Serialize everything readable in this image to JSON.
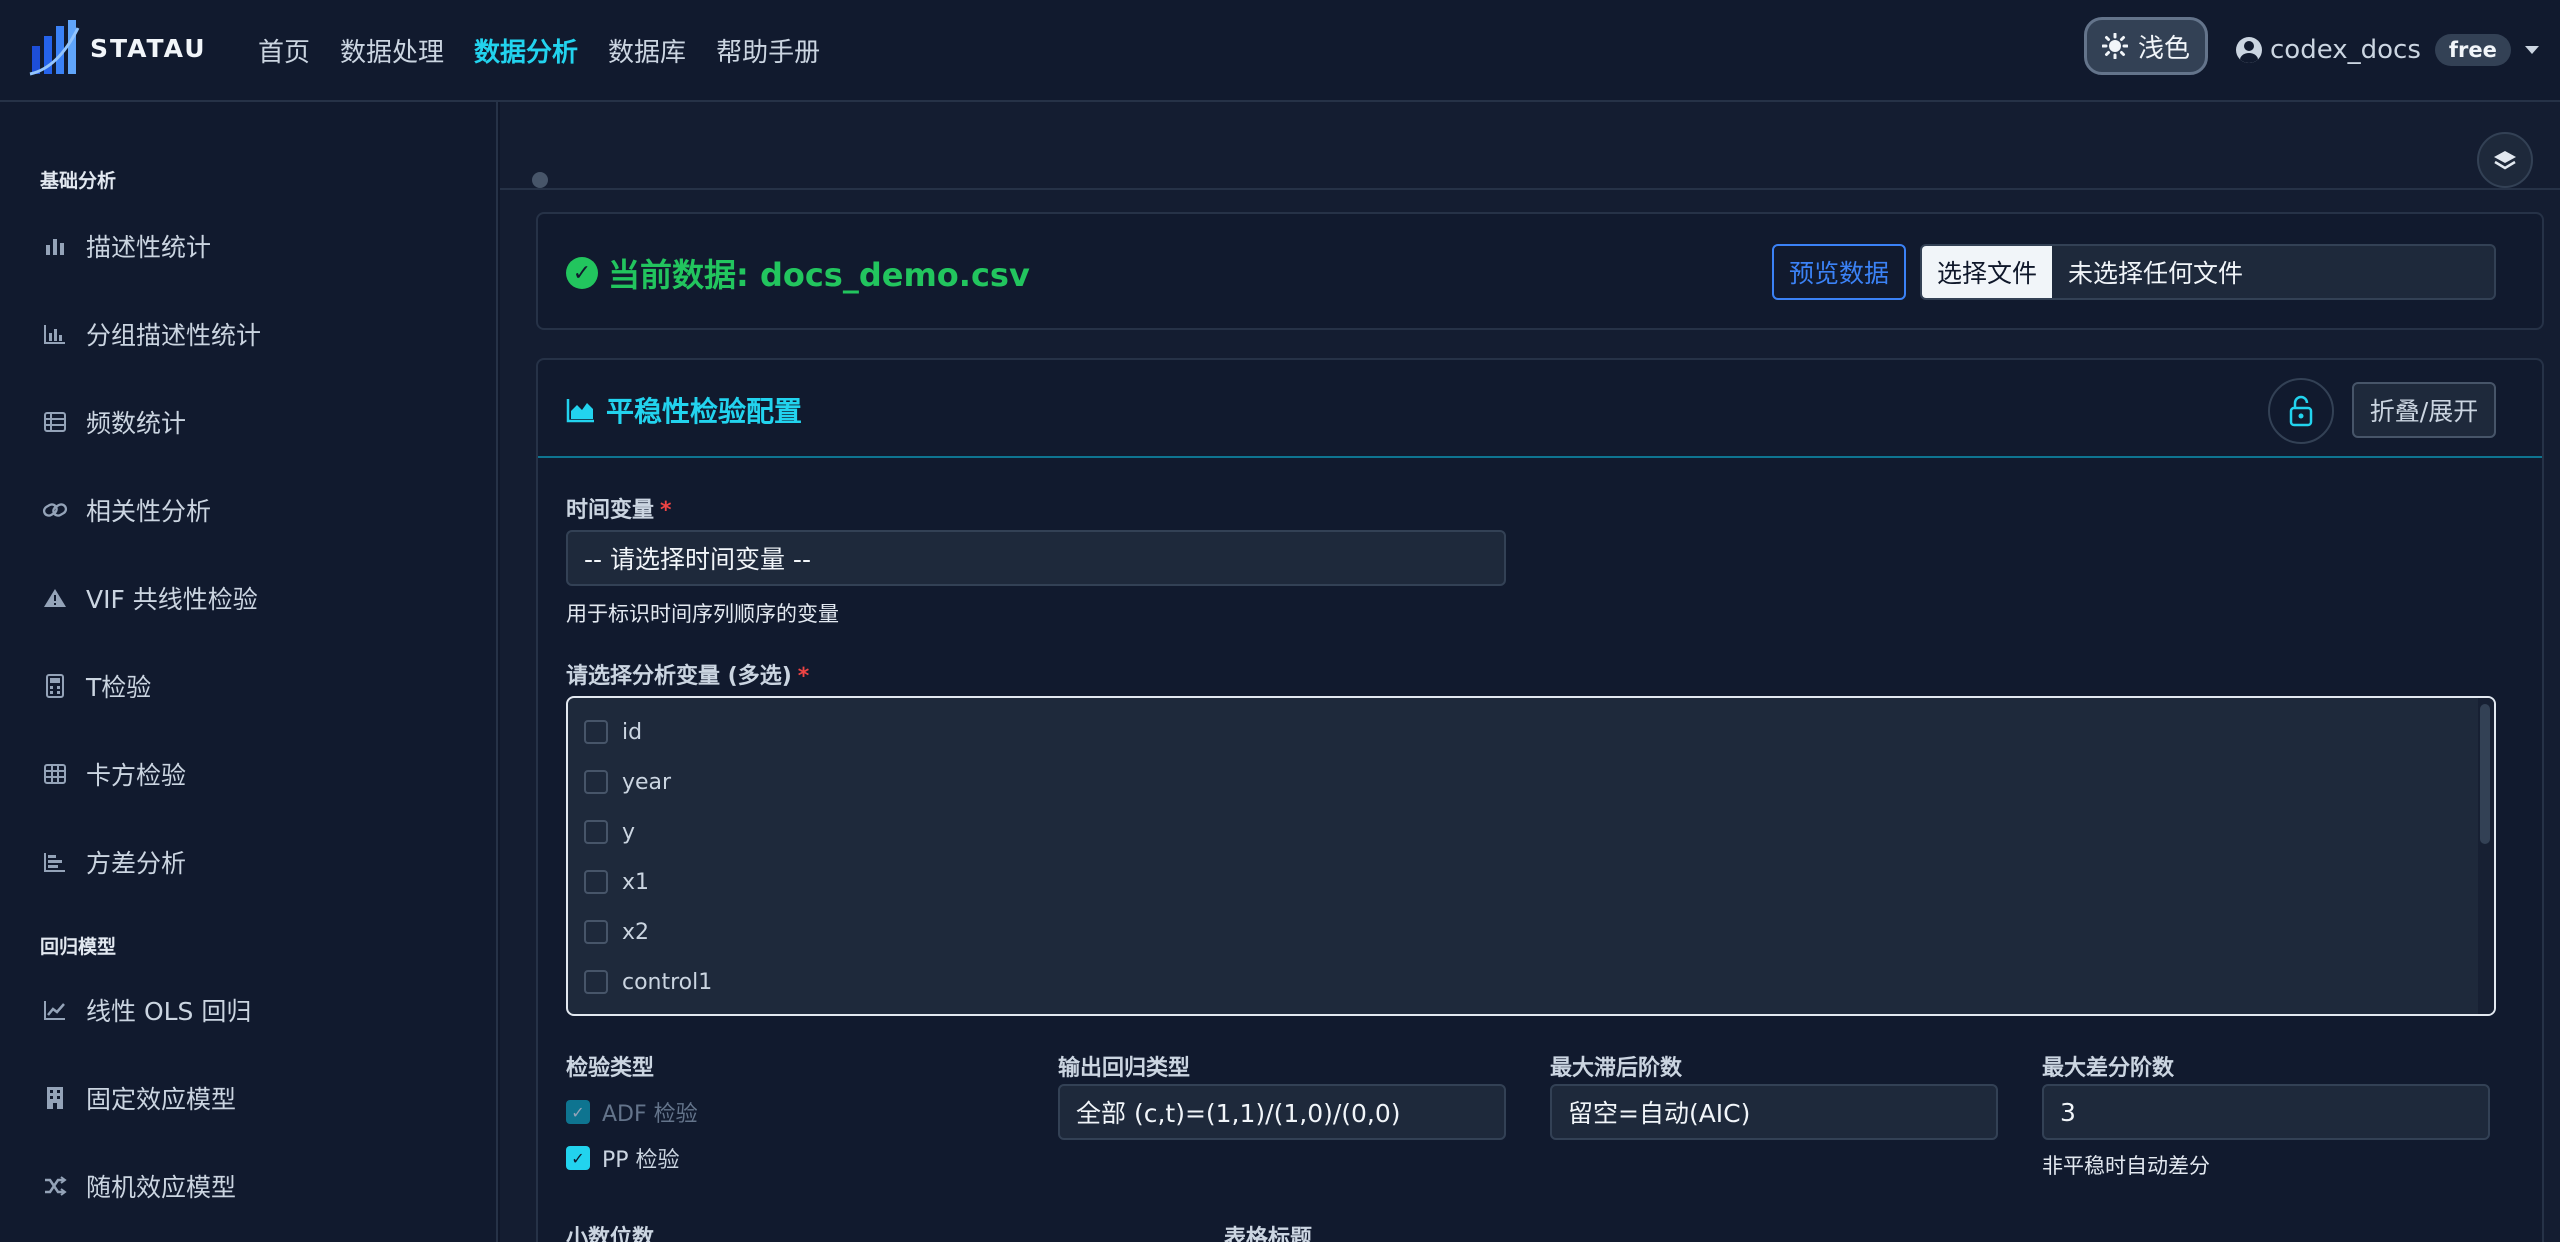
{
  "brand": {
    "name": "STATAU"
  },
  "nav": {
    "items": [
      {
        "label": "首页"
      },
      {
        "label": "数据处理"
      },
      {
        "label": "数据分析"
      },
      {
        "label": "数据库"
      },
      {
        "label": "帮助手册"
      }
    ],
    "active_index": 2
  },
  "theme_toggle": {
    "label": "浅色",
    "icon": "sun-icon"
  },
  "user": {
    "name": "codex_docs",
    "plan": "free",
    "icon": "user-circle-icon"
  },
  "sidebar": {
    "sections": [
      {
        "title": "基础分析",
        "items": [
          {
            "label": "描述性统计",
            "icon": "bar-chart-icon"
          },
          {
            "label": "分组描述性统计",
            "icon": "grouped-bar-chart-icon"
          },
          {
            "label": "频数统计",
            "icon": "table-icon"
          },
          {
            "label": "相关性分析",
            "icon": "link-icon"
          },
          {
            "label": "VIF 共线性检验",
            "icon": "warning-icon"
          },
          {
            "label": "T检验",
            "icon": "calculator-icon"
          },
          {
            "label": "卡方检验",
            "icon": "grid-icon"
          },
          {
            "label": "方差分析",
            "icon": "bar-chart-steps-icon"
          }
        ]
      },
      {
        "title": "回归模型",
        "items": [
          {
            "label": "线性 OLS 回归",
            "icon": "line-chart-icon"
          },
          {
            "label": "固定效应模型",
            "icon": "building-icon"
          },
          {
            "label": "随机效应模型",
            "icon": "shuffle-icon"
          }
        ]
      }
    ]
  },
  "data_card": {
    "title": "当前数据: docs_demo.csv",
    "preview_label": "预览数据",
    "file_choose_label": "选择文件",
    "file_status": "未选择任何文件"
  },
  "config": {
    "title": "平稳性检验配置",
    "fold_label": "折叠/展开",
    "time_var": {
      "label": "时间变量",
      "required_mark": "*",
      "selected": "-- 请选择时间变量 --",
      "help": "用于标识时间序列顺序的变量"
    },
    "vars": {
      "label": "请选择分析变量 (多选)",
      "required_mark": "*",
      "options": [
        "id",
        "year",
        "y",
        "x1",
        "x2",
        "control1"
      ]
    },
    "test_type": {
      "label": "检验类型",
      "options": [
        {
          "label": "ADF 检验",
          "checked": true,
          "disabled": true
        },
        {
          "label": "PP 检验",
          "checked": true,
          "disabled": false
        }
      ]
    },
    "regression_type": {
      "label": "输出回归类型",
      "selected": "全部 (c,t)=(1,1)/(1,0)/(0,0)"
    },
    "max_lag": {
      "label": "最大滞后阶数",
      "placeholder": "留空=自动(AIC)"
    },
    "max_diff": {
      "label": "最大差分阶数",
      "value": "3",
      "help": "非平稳时自动差分"
    },
    "decimals": {
      "label": "小数位数"
    },
    "table_title": {
      "label": "表格标题"
    }
  },
  "colors": {
    "accent": "#22d3ee",
    "success": "#22c55e",
    "primary": "#3b82f6",
    "background": "#0f172a"
  }
}
